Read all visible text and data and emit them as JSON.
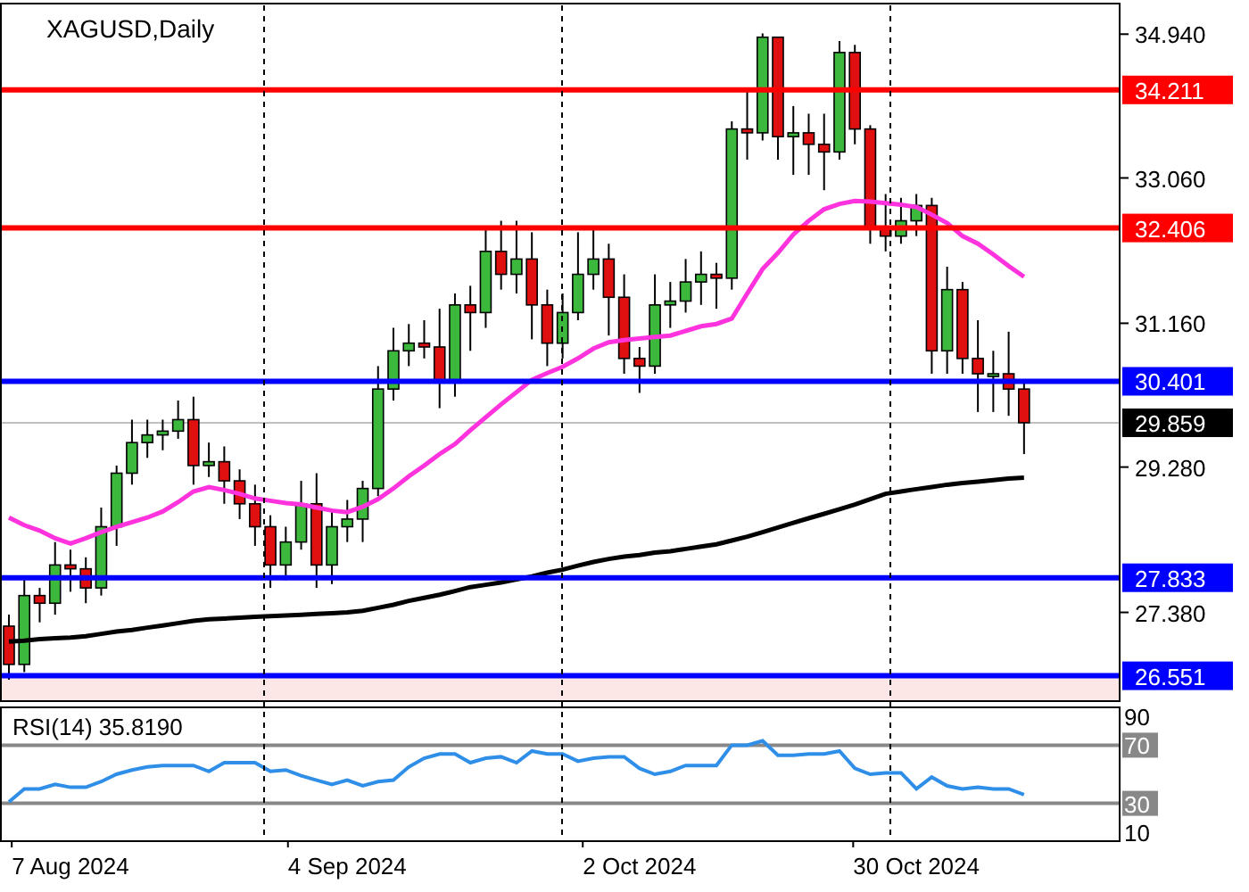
{
  "price_chart": {
    "chart_data": {
      "type": "candlestick",
      "title": "XAGUSD,Daily",
      "categories": [
        null,
        null,
        null,
        null,
        "7 Aug 2024",
        null,
        null,
        null,
        null,
        null,
        null,
        null,
        null,
        null,
        null,
        null,
        null,
        null,
        null,
        null,
        null,
        null,
        "4 Sep 2024",
        null,
        null,
        null,
        null,
        null,
        null,
        null,
        null,
        null,
        null,
        null,
        null,
        null,
        null,
        null,
        null,
        null,
        null,
        "2 Oct 2024",
        null,
        null,
        null,
        null,
        null,
        null,
        null,
        null,
        null,
        null,
        null,
        null,
        null,
        null,
        null,
        null,
        null,
        "30 Oct 2024",
        null,
        null,
        null,
        null,
        null,
        null,
        null
      ],
      "ylim": [
        26.22,
        35.34
      ],
      "ref_lines": [
        {
          "axis": "y",
          "value": 34.211,
          "label": "34.211",
          "color": "#ff0000"
        },
        {
          "axis": "y",
          "value": 32.406,
          "label": "32.406",
          "color": "#ff0000"
        },
        {
          "axis": "y",
          "value": 30.401,
          "label": "30.401",
          "color": "#0000ff"
        },
        {
          "axis": "y",
          "value": 27.833,
          "label": "27.833",
          "color": "#0000ff"
        },
        {
          "axis": "y",
          "value": 26.551,
          "label": "26.551",
          "color": "#0000ff"
        },
        {
          "axis": "y",
          "value": 29.859,
          "label": "29.859",
          "color": "#c0c0c0"
        }
      ],
      "yticks": [
        {
          "value": 34.94,
          "label": "34.940"
        },
        {
          "value": 33.06,
          "label": "33.060"
        },
        {
          "value": 31.16,
          "label": "31.160"
        },
        {
          "value": 29.28,
          "label": "29.280"
        },
        {
          "value": 27.38,
          "label": "27.380"
        }
      ],
      "ohlc": [
        [
          27.2,
          27.35,
          26.5,
          26.7
        ],
        [
          26.7,
          27.85,
          26.6,
          27.6
        ],
        [
          27.6,
          27.7,
          27.25,
          27.5
        ],
        [
          27.5,
          28.3,
          27.35,
          28.0
        ],
        [
          28.0,
          28.2,
          27.65,
          27.95
        ],
        [
          27.95,
          28.1,
          27.5,
          27.7
        ],
        [
          27.7,
          28.75,
          27.6,
          28.5
        ],
        [
          28.5,
          29.3,
          28.25,
          29.2
        ],
        [
          29.2,
          29.9,
          29.05,
          29.6
        ],
        [
          29.6,
          29.9,
          29.4,
          29.7
        ],
        [
          29.7,
          29.9,
          29.5,
          29.75
        ],
        [
          29.75,
          30.15,
          29.65,
          29.9
        ],
        [
          29.9,
          30.2,
          29.05,
          29.3
        ],
        [
          29.3,
          29.6,
          29.15,
          29.35
        ],
        [
          29.35,
          29.55,
          28.8,
          29.1
        ],
        [
          29.1,
          29.25,
          28.6,
          28.8
        ],
        [
          28.8,
          29.05,
          28.25,
          28.5
        ],
        [
          28.5,
          28.65,
          27.7,
          28.0
        ],
        [
          28.0,
          28.5,
          27.8,
          28.3
        ],
        [
          28.3,
          29.1,
          28.2,
          28.8
        ],
        [
          28.8,
          29.2,
          27.7,
          28.0
        ],
        [
          28.0,
          28.7,
          27.75,
          28.5
        ],
        [
          28.5,
          28.85,
          28.3,
          28.6
        ],
        [
          28.6,
          29.1,
          28.3,
          29.0
        ],
        [
          29.0,
          30.6,
          28.9,
          30.3
        ],
        [
          30.3,
          31.1,
          30.15,
          30.8
        ],
        [
          30.8,
          31.15,
          30.6,
          30.9
        ],
        [
          30.9,
          31.2,
          30.7,
          30.85
        ],
        [
          30.85,
          31.35,
          30.05,
          30.4
        ],
        [
          30.4,
          31.55,
          30.2,
          31.4
        ],
        [
          31.4,
          31.65,
          30.8,
          31.3
        ],
        [
          31.3,
          32.4,
          31.1,
          32.1
        ],
        [
          32.1,
          32.5,
          31.6,
          31.8
        ],
        [
          31.8,
          32.5,
          31.55,
          32.0
        ],
        [
          32.0,
          32.35,
          30.95,
          31.4
        ],
        [
          31.4,
          31.6,
          30.6,
          30.9
        ],
        [
          30.9,
          31.55,
          30.7,
          31.3
        ],
        [
          31.3,
          32.35,
          31.2,
          31.8
        ],
        [
          31.8,
          32.4,
          31.6,
          32.0
        ],
        [
          32.0,
          32.2,
          31.0,
          31.5
        ],
        [
          31.5,
          31.8,
          30.5,
          30.7
        ],
        [
          30.7,
          30.85,
          30.25,
          30.6
        ],
        [
          30.6,
          31.8,
          30.5,
          31.4
        ],
        [
          31.4,
          31.7,
          31.1,
          31.45
        ],
        [
          31.45,
          32.0,
          31.3,
          31.7
        ],
        [
          31.7,
          32.1,
          31.4,
          31.8
        ],
        [
          31.8,
          31.95,
          31.35,
          31.75
        ],
        [
          31.75,
          33.8,
          31.6,
          33.7
        ],
        [
          33.7,
          34.2,
          33.3,
          33.65
        ],
        [
          33.65,
          34.95,
          33.55,
          34.9
        ],
        [
          34.9,
          34.9,
          33.3,
          33.6
        ],
        [
          33.6,
          34.0,
          33.1,
          33.65
        ],
        [
          33.65,
          33.9,
          33.1,
          33.5
        ],
        [
          33.5,
          33.9,
          32.9,
          33.4
        ],
        [
          33.4,
          34.85,
          33.3,
          34.7
        ],
        [
          34.7,
          34.8,
          33.5,
          33.7
        ],
        [
          33.7,
          33.75,
          32.2,
          32.4
        ],
        [
          32.4,
          32.85,
          32.1,
          32.3
        ],
        [
          32.3,
          32.8,
          32.2,
          32.5
        ],
        [
          32.5,
          32.85,
          32.3,
          32.7
        ],
        [
          32.7,
          32.8,
          30.5,
          30.8
        ],
        [
          30.8,
          31.9,
          30.5,
          31.6
        ],
        [
          31.6,
          31.7,
          30.5,
          30.7
        ],
        [
          30.7,
          31.2,
          30.0,
          30.5
        ],
        [
          30.5,
          30.8,
          30.0,
          30.5
        ],
        [
          30.5,
          31.05,
          29.95,
          30.3
        ],
        [
          30.3,
          30.4,
          29.45,
          29.86
        ]
      ],
      "series": [
        {
          "type": "line",
          "color": "#000000",
          "values": [
            27.0,
            27.01,
            27.03,
            27.04,
            27.05,
            27.07,
            27.1,
            27.13,
            27.15,
            27.18,
            27.21,
            27.24,
            27.27,
            27.29,
            27.3,
            27.31,
            27.32,
            27.33,
            27.34,
            27.35,
            27.36,
            27.37,
            27.38,
            27.4,
            27.44,
            27.48,
            27.53,
            27.57,
            27.61,
            27.66,
            27.71,
            27.74,
            27.77,
            27.81,
            27.85,
            27.9,
            27.94,
            27.99,
            28.04,
            28.08,
            28.11,
            28.13,
            28.16,
            28.18,
            28.21,
            28.24,
            28.27,
            28.32,
            28.37,
            28.43,
            28.49,
            28.55,
            28.61,
            28.67,
            28.73,
            28.79,
            28.86,
            28.93,
            28.96,
            28.99,
            29.02,
            29.05,
            29.07,
            29.09,
            29.11,
            29.13,
            29.14
          ]
        },
        {
          "type": "line",
          "color": "#ff33dd",
          "values": [
            28.62,
            28.52,
            28.45,
            28.35,
            28.28,
            28.35,
            28.43,
            28.5,
            28.56,
            28.62,
            28.7,
            28.82,
            28.96,
            29.02,
            28.98,
            28.93,
            28.87,
            28.84,
            28.81,
            28.79,
            28.75,
            28.71,
            28.69,
            28.76,
            28.86,
            29.0,
            29.16,
            29.3,
            29.45,
            29.58,
            29.76,
            29.93,
            30.1,
            30.26,
            30.42,
            30.51,
            30.59,
            30.7,
            30.83,
            30.91,
            30.94,
            30.96,
            30.98,
            31.0,
            31.06,
            31.12,
            31.15,
            31.22,
            31.55,
            31.87,
            32.08,
            32.32,
            32.5,
            32.65,
            32.72,
            32.76,
            32.75,
            32.73,
            32.71,
            32.68,
            32.58,
            32.47,
            32.3,
            32.2,
            32.06,
            31.91,
            31.77
          ]
        }
      ]
    },
    "label_boxes": [
      {
        "color": "#ff0000"
      },
      {
        "color": "#ff0000"
      },
      {
        "color": "#0000ff"
      },
      {
        "color": "#0000ff"
      },
      {
        "color": "#0000ff"
      },
      {
        "color": "#000000"
      }
    ]
  },
  "rsi_chart": {
    "chart_data": {
      "type": "line",
      "title": "RSI(14) 35.8190",
      "ylim": [
        4,
        96
      ],
      "yticks": [
        {
          "value": 90,
          "label": "90"
        },
        {
          "value": 70,
          "label": "70"
        },
        {
          "value": 30,
          "label": "30"
        },
        {
          "value": 10,
          "label": "10"
        }
      ],
      "series": [
        {
          "color": "#2f8fe8",
          "values": [
            31,
            40,
            40,
            43,
            41,
            41,
            45,
            50,
            53,
            55,
            56,
            56,
            56,
            52,
            58,
            58,
            58,
            52,
            53,
            49,
            46,
            43,
            46,
            42,
            45,
            46,
            55,
            61,
            64,
            64,
            58,
            61,
            62,
            58,
            66,
            64,
            64,
            59,
            61,
            62,
            62,
            54,
            50,
            52,
            56,
            56,
            56,
            70,
            70,
            73,
            63,
            63,
            64,
            64,
            66,
            54,
            50,
            51,
            51,
            40,
            48,
            42,
            40,
            41,
            40,
            40,
            36
          ]
        }
      ]
    },
    "boxed_levels": [
      false,
      true,
      true,
      false
    ]
  }
}
